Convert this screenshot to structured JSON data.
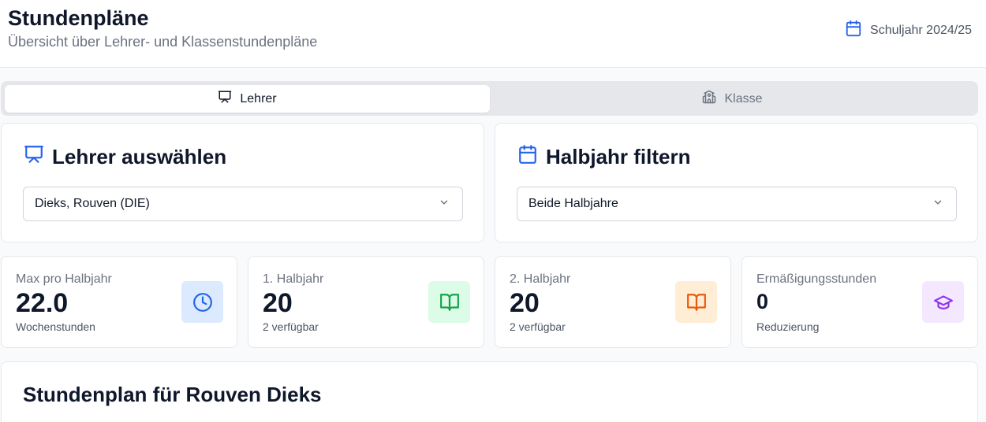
{
  "header": {
    "title": "Stundenpläne",
    "subtitle": "Übersicht über Lehrer- und Klassenstundenpläne",
    "school_year": "Schuljahr 2024/25"
  },
  "tabs": [
    {
      "label": "Lehrer",
      "icon": "presentation-icon",
      "active": true
    },
    {
      "label": "Klasse",
      "icon": "school-icon",
      "active": false
    }
  ],
  "teacher_select": {
    "title": "Lehrer auswählen",
    "value": "Dieks, Rouven (DIE)"
  },
  "semester_filter": {
    "title": "Halbjahr filtern",
    "value": "Beide Halbjahre"
  },
  "stats": [
    {
      "label": "Max pro Halbjahr",
      "value": "22.0",
      "sub": "Wochenstunden",
      "icon": "clock-icon",
      "bg": "#dbeafe",
      "fg": "#2563eb"
    },
    {
      "label": "1. Halbjahr",
      "value": "20",
      "sub": "2 verfügbar",
      "icon": "book-open-icon",
      "bg": "#dcfce7",
      "fg": "#16a34a"
    },
    {
      "label": "2. Halbjahr",
      "value": "20",
      "sub": "2 verfügbar",
      "icon": "book-open-icon",
      "bg": "#ffedd5",
      "fg": "#ea580c"
    },
    {
      "label": "Ermäßigungsstunden",
      "value": "0",
      "sub": "Reduzierung",
      "icon": "graduation-cap-icon",
      "bg": "#f3e8ff",
      "fg": "#9333ea"
    }
  ],
  "plan": {
    "title": "Stundenplan für Rouven Dieks"
  },
  "colors": {
    "accent": "#2563eb"
  }
}
